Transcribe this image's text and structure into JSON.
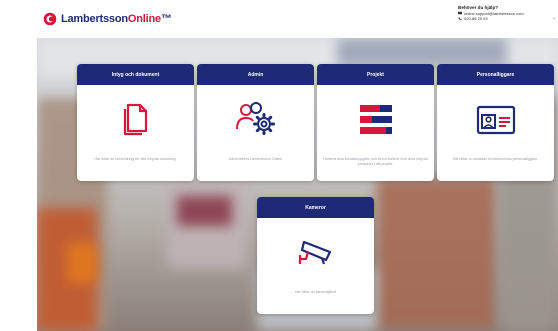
{
  "header": {
    "logo_main": "Lambertsson",
    "logo_accent": "Online",
    "logo_tm": "™",
    "support_title": "Behöver du hjälp?",
    "support_email": "online.support@lambertsson.com",
    "support_phone": "020-88 25 93",
    "more": "›"
  },
  "cards": [
    {
      "title": "Intyg och dokument",
      "desc": "Här hittar du kontrollintyg för alla inhyrda utrustning.",
      "icon": "document-icon"
    },
    {
      "title": "Admin",
      "desc": "Administrera Lambertsson Online",
      "icon": "users-gear-icon"
    },
    {
      "title": "Projekt",
      "desc": "Hantera dina kontaktuppgifter och få full kontroll över dina inhyrda produkter i ditt projekt.",
      "icon": "project-list-icon"
    },
    {
      "title": "Personalliggare",
      "desc": "Här hittar du avtalade till elektroniska personalliggare.",
      "icon": "id-card-icon"
    },
    {
      "title": "Kameror",
      "desc": "Här hittar du kameratjänst",
      "icon": "security-camera-icon"
    }
  ],
  "colors": {
    "primary": "#1e2a78",
    "accent": "#d9143d"
  }
}
